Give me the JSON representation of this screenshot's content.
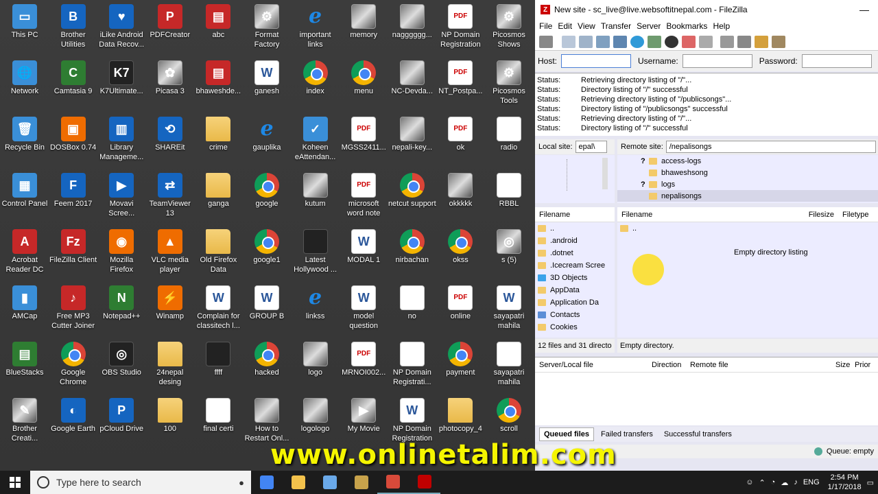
{
  "desktop": {
    "icons": [
      {
        "label": "This PC",
        "icon": "computer-icon",
        "kind": "sys",
        "glyph": "▭"
      },
      {
        "label": "Brother Utilities",
        "icon": "brother-utilities-icon",
        "kind": "blue",
        "glyph": "B"
      },
      {
        "label": "iLike Android Data Recov...",
        "icon": "ilike-android-icon",
        "kind": "blue",
        "glyph": "♥"
      },
      {
        "label": "PDFCreator",
        "icon": "pdfcreator-icon",
        "kind": "red",
        "glyph": "P"
      },
      {
        "label": "abc",
        "icon": "winrar-archive-icon",
        "kind": "red",
        "glyph": "▤"
      },
      {
        "label": "Format Factory",
        "icon": "format-factory-icon",
        "kind": "img",
        "glyph": "⚙"
      },
      {
        "label": "important links",
        "icon": "internet-explorer-icon",
        "kind": "ie",
        "glyph": "e"
      },
      {
        "label": "memory",
        "icon": "image-file-icon",
        "kind": "img",
        "glyph": ""
      },
      {
        "label": "nagggggg...",
        "icon": "image-file-icon",
        "kind": "img",
        "glyph": ""
      },
      {
        "label": "NP Domain Registration",
        "icon": "pdf-file-icon",
        "kind": "pdf",
        "glyph": "PDF"
      },
      {
        "label": "Picosmos Shows",
        "icon": "picosmos-icon",
        "kind": "img",
        "glyph": "⚙"
      },
      {
        "label": "Network",
        "icon": "network-icon",
        "kind": "sys",
        "glyph": "🌐"
      },
      {
        "label": "Camtasia 9",
        "icon": "camtasia-icon",
        "kind": "green",
        "glyph": "C"
      },
      {
        "label": "K7Ultimate...",
        "icon": "k7-icon",
        "kind": "dark",
        "glyph": "K7"
      },
      {
        "label": "Picasa 3",
        "icon": "picasa-icon",
        "kind": "img",
        "glyph": "✿"
      },
      {
        "label": "bhaweshde...",
        "icon": "winrar-archive-icon",
        "kind": "red",
        "glyph": "▤"
      },
      {
        "label": "ganesh",
        "icon": "word-file-icon",
        "kind": "word",
        "glyph": "W"
      },
      {
        "label": "index",
        "icon": "chrome-icon",
        "kind": "chrome",
        "glyph": ""
      },
      {
        "label": "menu",
        "icon": "chrome-icon",
        "kind": "chrome",
        "glyph": ""
      },
      {
        "label": "NC-Devda...",
        "icon": "image-file-icon",
        "kind": "img",
        "glyph": ""
      },
      {
        "label": "NT_Postpa...",
        "icon": "pdf-file-icon",
        "kind": "pdf",
        "glyph": "PDF"
      },
      {
        "label": "Picosmos Tools",
        "icon": "picosmos-icon",
        "kind": "img",
        "glyph": "⚙"
      },
      {
        "label": "Recycle Bin",
        "icon": "recycle-bin-icon",
        "kind": "sys",
        "glyph": "🗑"
      },
      {
        "label": "DOSBox 0.74",
        "icon": "dosbox-icon",
        "kind": "orange",
        "glyph": "▣"
      },
      {
        "label": "Library Manageme...",
        "icon": "library-management-icon",
        "kind": "blue",
        "glyph": "▥"
      },
      {
        "label": "SHAREit",
        "icon": "shareit-icon",
        "kind": "blue",
        "glyph": "⟲"
      },
      {
        "label": "crime",
        "icon": "folder-zip-icon",
        "kind": "folder",
        "glyph": ""
      },
      {
        "label": "gauplika",
        "icon": "internet-explorer-icon",
        "kind": "ie",
        "glyph": "e"
      },
      {
        "label": "Koheen eAttendan...",
        "icon": "koheen-icon",
        "kind": "sys",
        "glyph": "✓"
      },
      {
        "label": "MGSS2411...",
        "icon": "pdf-file-icon",
        "kind": "pdf",
        "glyph": "PDF"
      },
      {
        "label": "nepali-key...",
        "icon": "keyboard-image-icon",
        "kind": "img",
        "glyph": ""
      },
      {
        "label": "ok",
        "icon": "pdf-file-icon",
        "kind": "pdf",
        "glyph": "PDF"
      },
      {
        "label": "radio",
        "icon": "blank-file-icon",
        "kind": "blank",
        "glyph": ""
      },
      {
        "label": "Control Panel",
        "icon": "control-panel-icon",
        "kind": "sys",
        "glyph": "▦"
      },
      {
        "label": "Feem 2017",
        "icon": "feem-icon",
        "kind": "blue",
        "glyph": "F"
      },
      {
        "label": "Movavi Scree...",
        "icon": "movavi-icon",
        "kind": "blue",
        "glyph": "▶"
      },
      {
        "label": "TeamViewer 13",
        "icon": "teamviewer-icon",
        "kind": "blue",
        "glyph": "⇄"
      },
      {
        "label": "ganga",
        "icon": "folder-zip-icon",
        "kind": "folder",
        "glyph": ""
      },
      {
        "label": "google",
        "icon": "chrome-icon",
        "kind": "chrome",
        "glyph": ""
      },
      {
        "label": "kutum",
        "icon": "image-file-icon",
        "kind": "img",
        "glyph": ""
      },
      {
        "label": "microsoft word note",
        "icon": "pdf-file-icon",
        "kind": "pdf",
        "glyph": "PDF"
      },
      {
        "label": "netcut support",
        "icon": "chrome-icon",
        "kind": "chrome",
        "glyph": ""
      },
      {
        "label": "okkkkk",
        "icon": "image-file-icon",
        "kind": "img",
        "glyph": ""
      },
      {
        "label": "RBBL",
        "icon": "document-icon",
        "kind": "blank",
        "glyph": ""
      },
      {
        "label": "Acrobat Reader DC",
        "icon": "acrobat-icon",
        "kind": "red",
        "glyph": "A"
      },
      {
        "label": "FileZilla Client",
        "icon": "filezilla-icon",
        "kind": "red",
        "glyph": "Fz"
      },
      {
        "label": "Mozilla Firefox",
        "icon": "firefox-icon",
        "kind": "orange",
        "glyph": "◉"
      },
      {
        "label": "VLC media player",
        "icon": "vlc-icon",
        "kind": "orange",
        "glyph": "▲"
      },
      {
        "label": "Old Firefox Data",
        "icon": "folder-zip-icon",
        "kind": "folder",
        "glyph": ""
      },
      {
        "label": "google1",
        "icon": "chrome-icon",
        "kind": "chrome",
        "glyph": ""
      },
      {
        "label": "Latest Hollywood ...",
        "icon": "image-file-icon",
        "kind": "dark",
        "glyph": ""
      },
      {
        "label": "MODAL 1",
        "icon": "word-file-icon",
        "kind": "word",
        "glyph": "W"
      },
      {
        "label": "nirbachan",
        "icon": "chrome-icon",
        "kind": "chrome",
        "glyph": ""
      },
      {
        "label": "okss",
        "icon": "chrome-icon",
        "kind": "chrome",
        "glyph": ""
      },
      {
        "label": "s (5)",
        "icon": "image-file-icon",
        "kind": "img",
        "glyph": "◎"
      },
      {
        "label": "AMCap",
        "icon": "amcap-icon",
        "kind": "sys",
        "glyph": "▮"
      },
      {
        "label": "Free MP3 Cutter Joiner",
        "icon": "mp3-cutter-icon",
        "kind": "red",
        "glyph": "♪"
      },
      {
        "label": "Notepad++",
        "icon": "notepadpp-icon",
        "kind": "green",
        "glyph": "N"
      },
      {
        "label": "Winamp",
        "icon": "winamp-icon",
        "kind": "orange",
        "glyph": "⚡"
      },
      {
        "label": "Complain for classitech l...",
        "icon": "word-file-icon",
        "kind": "word",
        "glyph": "W"
      },
      {
        "label": "GROUP B",
        "icon": "word-file-icon",
        "kind": "word",
        "glyph": "W"
      },
      {
        "label": "linkss",
        "icon": "internet-explorer-icon",
        "kind": "ie",
        "glyph": "e"
      },
      {
        "label": "model question",
        "icon": "word-file-icon",
        "kind": "word",
        "glyph": "W"
      },
      {
        "label": "no",
        "icon": "blank-file-icon",
        "kind": "blank",
        "glyph": ""
      },
      {
        "label": "online",
        "icon": "pdf-file-icon",
        "kind": "pdf",
        "glyph": "PDF"
      },
      {
        "label": "sayapatri mahila",
        "icon": "word-file-icon",
        "kind": "word",
        "glyph": "W"
      },
      {
        "label": "BlueStacks",
        "icon": "bluestacks-icon",
        "kind": "green",
        "glyph": "▤"
      },
      {
        "label": "Google Chrome",
        "icon": "chrome-icon",
        "kind": "chrome",
        "glyph": ""
      },
      {
        "label": "OBS Studio",
        "icon": "obs-icon",
        "kind": "dark",
        "glyph": "◎"
      },
      {
        "label": "24nepal desing",
        "icon": "folder-zip-icon",
        "kind": "folder",
        "glyph": ""
      },
      {
        "label": "ffff",
        "icon": "image-file-icon",
        "kind": "dark",
        "glyph": ""
      },
      {
        "label": "hacked",
        "icon": "chrome-icon",
        "kind": "chrome",
        "glyph": ""
      },
      {
        "label": "logo",
        "icon": "image-file-icon",
        "kind": "img",
        "glyph": ""
      },
      {
        "label": "MRNOI002...",
        "icon": "pdf-file-icon",
        "kind": "pdf",
        "glyph": "PDF"
      },
      {
        "label": "NP Domain Registrati...",
        "icon": "document-icon",
        "kind": "blank",
        "glyph": ""
      },
      {
        "label": "payment",
        "icon": "chrome-icon",
        "kind": "chrome",
        "glyph": ""
      },
      {
        "label": "sayapatri mahila",
        "icon": "document-icon",
        "kind": "blank",
        "glyph": ""
      },
      {
        "label": "Brother Creati...",
        "icon": "brother-creative-icon",
        "kind": "img",
        "glyph": "✎"
      },
      {
        "label": "Google Earth",
        "icon": "google-earth-icon",
        "kind": "blue",
        "glyph": "◐"
      },
      {
        "label": "pCloud Drive",
        "icon": "pcloud-icon",
        "kind": "blue",
        "glyph": "P"
      },
      {
        "label": "100",
        "icon": "folder-zip-icon",
        "kind": "folder",
        "glyph": ""
      },
      {
        "label": "final certi",
        "icon": "document-icon",
        "kind": "blank",
        "glyph": ""
      },
      {
        "label": "How to Restart Onl...",
        "icon": "image-file-icon",
        "kind": "img",
        "glyph": ""
      },
      {
        "label": "logologo",
        "icon": "image-file-icon",
        "kind": "img",
        "glyph": ""
      },
      {
        "label": "My Movie",
        "icon": "movie-maker-icon",
        "kind": "img",
        "glyph": "▶"
      },
      {
        "label": "NP Domain Registration",
        "icon": "word-file-icon",
        "kind": "word",
        "glyph": "W"
      },
      {
        "label": "photocopy_4",
        "icon": "folder-zip-icon",
        "kind": "folder",
        "glyph": ""
      },
      {
        "label": "scroll",
        "icon": "chrome-icon",
        "kind": "chrome",
        "glyph": ""
      }
    ]
  },
  "filezilla": {
    "title": "New site - sc_live@live.websoftitnepal.com - FileZilla",
    "app_icon_glyph": "Z",
    "minimize_glyph": "—",
    "menu": [
      "File",
      "Edit",
      "View",
      "Transfer",
      "Server",
      "Bookmarks",
      "Help"
    ],
    "quickconnect": {
      "host_label": "Host:",
      "host_value": "",
      "username_label": "Username:",
      "username_value": "",
      "password_label": "Password:",
      "password_value": "",
      "port_label": "Po"
    },
    "log": [
      {
        "k": "Status:",
        "v": "Retrieving directory listing of \"/\"..."
      },
      {
        "k": "Status:",
        "v": "Directory listing of \"/\" successful"
      },
      {
        "k": "Status:",
        "v": "Retrieving directory listing of \"/publicsongs\"..."
      },
      {
        "k": "Status:",
        "v": "Directory listing of \"/publicsongs\" successful"
      },
      {
        "k": "Status:",
        "v": "Retrieving directory listing of \"/\"..."
      },
      {
        "k": "Status:",
        "v": "Directory listing of \"/\" successful"
      }
    ],
    "local": {
      "site_label": "Local site:",
      "site_value": "epal\\",
      "headers": {
        "filename": "Filename"
      },
      "files": [
        {
          "name": "..",
          "icon": "folder-icon",
          "kind": "folder"
        },
        {
          "name": ".android",
          "icon": "folder-icon",
          "kind": "folder"
        },
        {
          "name": ".dotnet",
          "icon": "folder-icon",
          "kind": "folder"
        },
        {
          "name": ".Icecream Scree",
          "icon": "folder-icon",
          "kind": "folder"
        },
        {
          "name": "3D Objects",
          "icon": "3d-objects-icon",
          "kind": "obj"
        },
        {
          "name": "AppData",
          "icon": "folder-icon",
          "kind": "folder"
        },
        {
          "name": "Application Da",
          "icon": "folder-icon",
          "kind": "folder"
        },
        {
          "name": "Contacts",
          "icon": "contacts-icon",
          "kind": "con"
        },
        {
          "name": "Cookies",
          "icon": "folder-icon",
          "kind": "folder"
        }
      ],
      "status": "12 files and 31 directo"
    },
    "remote": {
      "site_label": "Remote site:",
      "site_value": "/nepalisongs",
      "tree": [
        {
          "name": "access-logs",
          "unknown": "?"
        },
        {
          "name": "bhaweshsong",
          "unknown": ""
        },
        {
          "name": "logs",
          "unknown": "?"
        },
        {
          "name": "nepalisongs",
          "unknown": ""
        }
      ],
      "headers": {
        "filename": "Filename",
        "filesize": "Filesize",
        "filetype": "Filetype"
      },
      "files": [
        {
          "name": "..",
          "icon": "folder-icon"
        }
      ],
      "empty_text": "Empty directory listing",
      "status": "Empty directory."
    },
    "queue": {
      "headers": {
        "server": "Server/Local file",
        "direction": "Direction",
        "remote": "Remote file",
        "size": "Size",
        "priority": "Prior"
      },
      "tabs": [
        {
          "label": "Queued files",
          "active": true
        },
        {
          "label": "Failed transfers",
          "active": false
        },
        {
          "label": "Successful transfers",
          "active": false
        }
      ],
      "status": "Queue: empty"
    }
  },
  "watermark": "www.onlinetalim.com",
  "taskbar": {
    "search_placeholder": "Type here to search",
    "language": "ENG",
    "time": "2:54 PM",
    "date": "1/17/2018",
    "apps": [
      {
        "icon": "chrome-taskbar-icon",
        "color": "#4285f4"
      },
      {
        "icon": "file-explorer-taskbar-icon",
        "color": "#f3c24c"
      },
      {
        "icon": "app-taskbar-icon",
        "color": "#6aa9e9"
      },
      {
        "icon": "winamp-taskbar-icon",
        "color": "#c7a24b"
      },
      {
        "icon": "camtasia-taskbar-icon",
        "color": "#d84a3a"
      },
      {
        "icon": "filezilla-taskbar-icon",
        "color": "#c00000"
      }
    ]
  }
}
